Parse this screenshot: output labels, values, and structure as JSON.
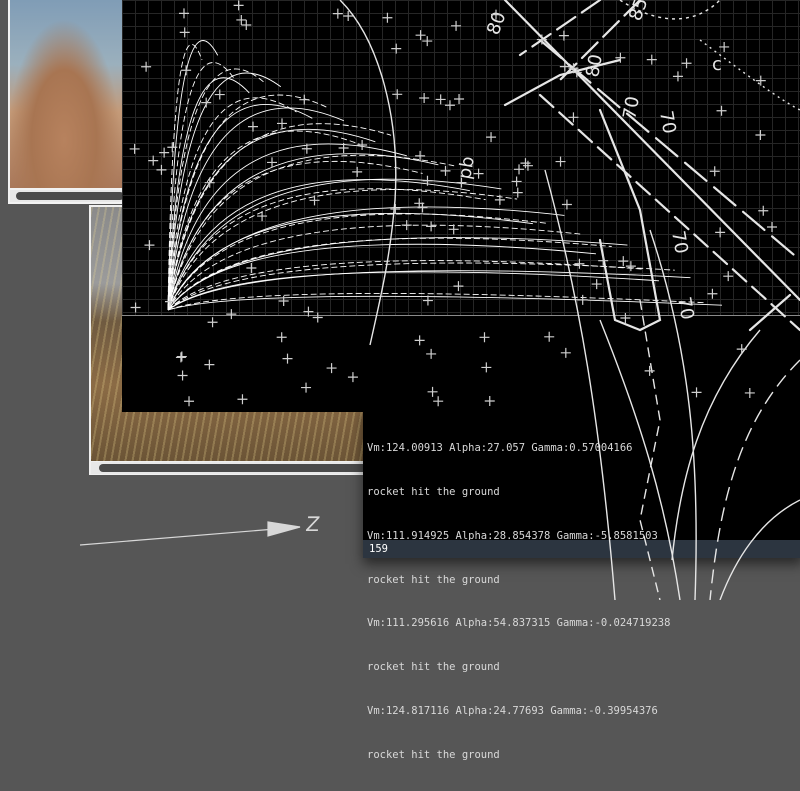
{
  "console": {
    "lines": [
      "Vm:124.00913 Alpha:27.057 Gamma:0.57004166",
      "rocket hit the ground",
      "Vm:111.914925 Alpha:28.854378 Gamma:-5.8581503",
      "rocket hit the ground",
      "Vm:111.295616 Alpha:54.837315 Gamma:-0.024719238",
      "rocket hit the ground",
      "Vm:124.817116 Alpha:24.77693 Gamma:-0.39954376",
      "rocket hit the ground"
    ],
    "status": "159"
  },
  "axis_arrow": {
    "label": "Z"
  },
  "overlay_labels": [
    "85",
    "80",
    "70",
    "70",
    "80",
    "70",
    "70",
    "pb",
    "c"
  ],
  "colors": {
    "background": "#565656",
    "plot_bg": "#000000",
    "trajectory": "#ffffff",
    "status_bar": "#2c3540"
  },
  "icons": [
    "scroll-thumb"
  ]
}
